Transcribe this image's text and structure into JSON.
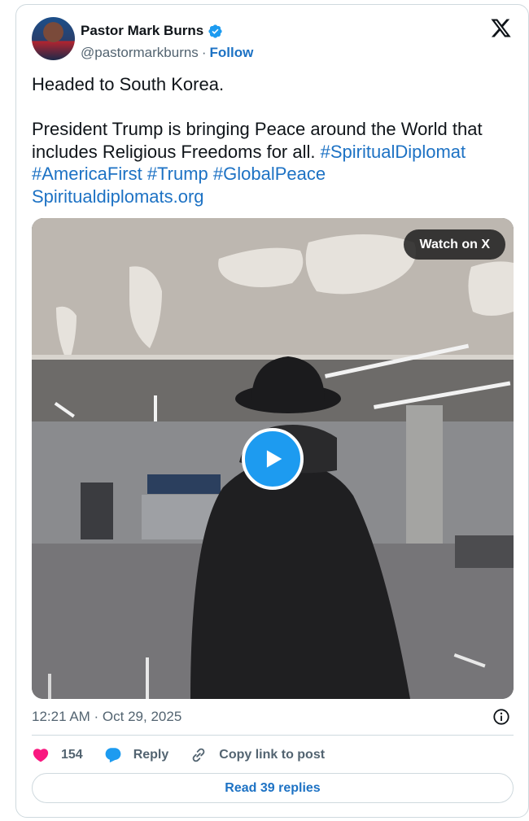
{
  "author": {
    "name": "Pastor Mark Burns",
    "handle": "@pastormarkburns",
    "separator": "·",
    "follow_label": "Follow",
    "verified_icon": "verified-badge-icon",
    "verified_color": "#1d9bf0"
  },
  "tweet": {
    "line1": "Headed to South Korea.",
    "line2_plain": "President Trump is bringing Peace around the World that includes Religious Freedoms for all. ",
    "hashtags": [
      "#SpiritualDiplomat",
      "#AmericaFirst",
      "#Trump",
      "#GlobalPeace"
    ],
    "link": "Spiritualdiplomats.org"
  },
  "media": {
    "watch_label": "Watch on X",
    "play_icon": "play-icon"
  },
  "timestamp": "12:21 AM · Oct 29, 2025",
  "actions": {
    "like_count": "154",
    "reply_label": "Reply",
    "copy_label": "Copy link to post"
  },
  "read_replies_label": "Read 39 replies",
  "colors": {
    "link": "#1d72c4",
    "like": "#f91880",
    "accent": "#1d9bf0",
    "muted": "#536471"
  }
}
